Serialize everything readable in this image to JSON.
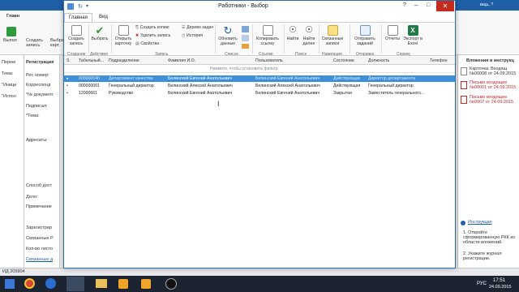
{
  "background_app": {
    "tab_main": "Главн",
    "left_btn": "Выпол",
    "btn_sozdat": "Создать запись",
    "btn_vybrat": "Выбрать карт.",
    "left_labels": [
      "Перем",
      "Тема:",
      "\"Иници",
      "\"Испол"
    ],
    "nav_items": [
      "Регистрация",
      "Рег. номер:",
      "Корреспонд",
      "*№ документ.",
      "Подписал:",
      "*Тема:",
      "Адресаты:",
      "Способ дост",
      "Дело:",
      "Примечание",
      "Зарегистрир",
      "Связанные Р",
      "Кол-во листо",
      "Связанные д"
    ],
    "right_panel": {
      "title": "Вложения и инструкц",
      "card": "Карточка: Входящ №00008 от 24.09.2015",
      "attach1": "Письмо входящее №00001 от 24.09.2015",
      "attach2": "Письмо входящее №0007 от 24.09.2015",
      "instr_title": "Инструкция",
      "instr1": "1. Откройте сформированную РКК из области вложений.",
      "instr2": "2. Укажите журнал регистрации."
    },
    "status_id": "ИД 205904",
    "title_right": "вщь, ?"
  },
  "dialog": {
    "title": "Работники - Выбор",
    "tabs": [
      "Главная",
      "Вид"
    ],
    "ribbon": {
      "sozdat_zapis": "Создать запись",
      "vybrat": "Выбрать",
      "otkryt_kartochku": "Открыть карточку",
      "sozdat_kopiyu": "Создать копию",
      "udalit_zapis": "Удалить запись",
      "svoistva": "Свойства",
      "derevo_zadach": "Дерево задач",
      "istoriya": "История",
      "obnovit": "Обновить данные",
      "kopirovat_ssylku": "Копировать ссылку",
      "naiti": "Найти",
      "naiti_dalee": "Найти далее",
      "svyazannye": "Связанные записи",
      "otpravit_zadanii": "Отправить заданий",
      "otchety": "Отчеты",
      "eksport": "Экспорт в Excel",
      "groups": [
        "Создание",
        "Действия",
        "Запись",
        "Список",
        "Ссылки",
        "Поиск",
        "Навигация",
        "Отправка",
        "Сервис"
      ]
    },
    "columns": [
      "S",
      "Табельный...",
      "Подразделение",
      "Фамилия И.О.",
      "Пользователь",
      "Состояние",
      "Должность",
      "Телефон"
    ],
    "filter_hint": "Нажмите, чтобы установить фильтр",
    "rows": [
      {
        "num": "000000040",
        "dept": "Департамент качества",
        "fio": "Белинский Евгений Анатольевич",
        "user": "Белинский Евгений Анатольевич",
        "state": "Действующая",
        "pos": "Директор департамента"
      },
      {
        "num": "000000001",
        "dept": "Генеральный директор",
        "fio": "Белинский Алексей Анатольевич",
        "user": "Белинский Алексей Анатольевич",
        "state": "Действующая",
        "pos": "Генеральный директор"
      },
      {
        "num": "12000661",
        "dept": "Руководство",
        "fio": "Белинский Евгений Анатольевич",
        "user": "Белинский Евгений Анатольевич",
        "state": "Закрытая",
        "pos": "Заместитель генерального..."
      }
    ]
  },
  "taskbar": {
    "time": "17:51",
    "date": "24.09.2015",
    "lang": "РУС"
  },
  "colors": {
    "accent": "#1f5fa8",
    "selection": "#3d8fd8",
    "taskbar": "#1c2431"
  }
}
